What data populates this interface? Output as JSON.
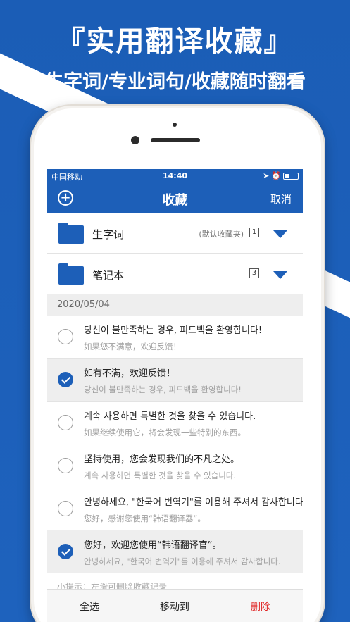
{
  "promo": {
    "headline": "『实用翻译收藏』",
    "subline": "生字词/专业词句/收藏随时翻看"
  },
  "status_bar": {
    "carrier": "中国移动",
    "time": "14:40"
  },
  "nav": {
    "title": "收藏",
    "cancel_label": "取消"
  },
  "folders": [
    {
      "name": "生字词",
      "note": "(默认收藏夹)",
      "count": "1"
    },
    {
      "name": "笔记本",
      "note": "",
      "count": "3"
    }
  ],
  "date_header": "2020/05/04",
  "items": [
    {
      "primary": "당신이 불만족하는 경우, 피드백을 환영합니다!",
      "secondary": "如果您不满意，欢迎反馈！",
      "checked": false
    },
    {
      "primary": "如有不满，欢迎反馈！",
      "secondary": "당신이 불만족하는 경우, 피드백을 환영합니다!",
      "checked": true
    },
    {
      "primary": "계속 사용하면 특별한 것을 찾을 수 있습니다.",
      "secondary": "如果继续使用它，将会发现一些特别的东西。",
      "checked": false
    },
    {
      "primary": "坚持使用，您会发现我们的不凡之处。",
      "secondary": "계속 사용하면 특별한 것을 찾을 수 있습니다.",
      "checked": false
    },
    {
      "primary": "안녕하세요, \"한국어 번역기\"를 이용해 주셔서 감사합니다.",
      "secondary": "您好，感谢您使用“韩语翻译器”。",
      "checked": false
    },
    {
      "primary": "您好，欢迎您使用“韩语翻译官”。",
      "secondary": "안녕하세요, \"한국어 번역기\"를 이용해 주셔서 감사합니다.",
      "checked": true
    }
  ],
  "tip": "小提示：左滑可删除收藏记录",
  "bottom_bar": {
    "select_all": "全选",
    "move_to": "移动到",
    "delete": "删除"
  },
  "colors": {
    "brand_blue": "#1d5fb8",
    "delete_red": "#e02020"
  },
  "icons": [
    "add-icon",
    "wifi-icon",
    "location-icon",
    "alarm-icon",
    "battery-icon",
    "folder-icon",
    "caret-down-icon",
    "radio-icon",
    "checkmark-icon"
  ]
}
